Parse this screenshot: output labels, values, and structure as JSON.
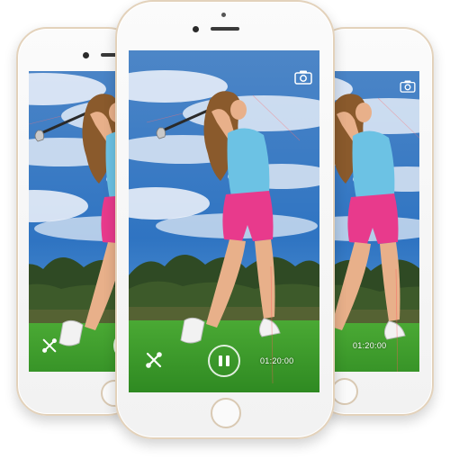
{
  "colors": {
    "sky": "#3d7fc4",
    "cloud": "#eef3fa",
    "grass": "#3f9d2e",
    "trees": "#2f4a24",
    "shirt": "#6cc2e4",
    "shorts": "#e83a8c",
    "hair": "#8a5a2c",
    "skin": "#e8b08a",
    "phone_frame": "#e3d2bb"
  },
  "phones": {
    "left": {
      "time": "",
      "toolbar_icon": "tools-icon"
    },
    "center": {
      "time": "01:20:00",
      "toolbar_icon": "tools-icon",
      "camera_icon": "camera-icon"
    },
    "right": {
      "time": "01:20:00",
      "camera_icon": "camera-icon"
    }
  }
}
